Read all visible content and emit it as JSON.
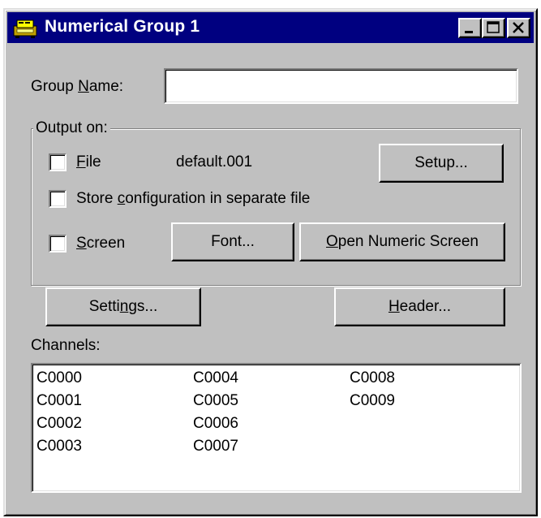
{
  "window": {
    "title": "Numerical Group 1",
    "buttons": [
      "minimize",
      "maximize",
      "close"
    ]
  },
  "group_name": {
    "label": "Group Name:",
    "value": ""
  },
  "output": {
    "legend": "Output on:",
    "file_label": "File",
    "file_checked": false,
    "file_name": "default.001",
    "setup_label": "Setup...",
    "store_config_label": "Store configuration in separate file",
    "store_config_checked": false,
    "screen_label": "Screen",
    "screen_checked": false,
    "font_label": "Font...",
    "open_numeric_label": "Open Numeric Screen"
  },
  "buttons": {
    "settings_label": "Settings...",
    "header_label": "Header..."
  },
  "channels": {
    "label": "Channels:",
    "items": [
      "C0000",
      "C0001",
      "C0002",
      "C0003",
      "C0004",
      "C0005",
      "C0006",
      "C0007",
      "C0008",
      "C0009"
    ]
  },
  "colors": {
    "titlebar": "#000080",
    "face": "#c0c0c0"
  }
}
